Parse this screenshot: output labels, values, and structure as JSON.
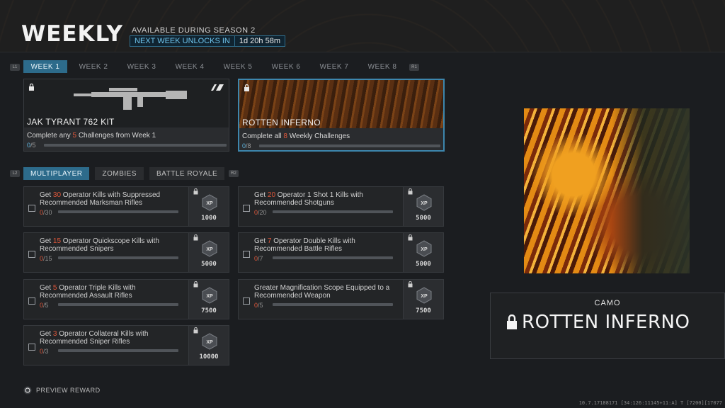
{
  "header": {
    "title": "WEEKLY",
    "subtitle": "AVAILABLE DURING SEASON 2",
    "unlock_label": "NEXT WEEK UNLOCKS IN",
    "unlock_time": "1d 20h 58m"
  },
  "hints": {
    "left_bumper": "L1",
    "right_bumper": "R1",
    "left_trigger": "L2",
    "right_trigger": "R2"
  },
  "weeks": [
    {
      "label": "WEEK 1",
      "active": true
    },
    {
      "label": "WEEK 2",
      "active": false
    },
    {
      "label": "WEEK 3",
      "active": false
    },
    {
      "label": "WEEK 4",
      "active": false
    },
    {
      "label": "WEEK 5",
      "active": false
    },
    {
      "label": "WEEK 6",
      "active": false
    },
    {
      "label": "WEEK 7",
      "active": false
    },
    {
      "label": "WEEK 8",
      "active": false
    }
  ],
  "rewards": [
    {
      "name": "JAK TYRANT 762 KIT",
      "desc_pre": "Complete any ",
      "desc_hl": "5",
      "desc_post": " Challenges from Week 1",
      "progress": "0",
      "total": "/5"
    },
    {
      "name": "ROTTEN INFERNO",
      "desc_pre": "Complete all ",
      "desc_hl": "8",
      "desc_post": " Weekly Challenges",
      "progress": "0",
      "total": "/8"
    }
  ],
  "modes": [
    {
      "label": "MULTIPLAYER",
      "active": true
    },
    {
      "label": "ZOMBIES",
      "active": false
    },
    {
      "label": "BATTLE ROYALE",
      "active": false
    }
  ],
  "challenges": [
    {
      "pre": "Get ",
      "hl": "30",
      "post": " Operator Kills with Suppressed Recommended Marksman Rifles",
      "progress": "0",
      "total": "/30",
      "xp": "1000"
    },
    {
      "pre": "Get ",
      "hl": "20",
      "post": " Operator 1 Shot 1 Kills with Recommended Shotguns",
      "progress": "0",
      "total": "/20",
      "xp": "5000"
    },
    {
      "pre": "Get ",
      "hl": "15",
      "post": " Operator Quickscope Kills with Recommended Snipers",
      "progress": "0",
      "total": "/15",
      "xp": "5000"
    },
    {
      "pre": "Get ",
      "hl": "7",
      "post": " Operator Double Kills with Recommended Battle Rifles",
      "progress": "0",
      "total": "/7",
      "xp": "5000"
    },
    {
      "pre": "Get ",
      "hl": "5",
      "post": " Operator Triple Kills with Recommended Assault Rifles",
      "progress": "0",
      "total": "/5",
      "xp": "7500"
    },
    {
      "pre": "",
      "hl": "",
      "post": "Greater Magnification Scope Equipped to a Recommended Weapon",
      "progress": "0",
      "total": "/5",
      "xp": "7500"
    },
    {
      "pre": "Get ",
      "hl": "3",
      "post": " Operator Collateral Kills with Recommended Sniper Rifles",
      "progress": "0",
      "total": "/3",
      "xp": "10000"
    }
  ],
  "xp_badge_text": "XP",
  "preview": {
    "type": "CAMO",
    "name": "ROTTEN INFERNO"
  },
  "footer": {
    "preview_label": "PREVIEW REWARD",
    "build_code": "10.7.17188171 [34:126:11145+11:A] T [7200][17077"
  },
  "colors": {
    "accent": "#2d6b8b",
    "highlight": "#e0573a",
    "progress": "#5fb3dd"
  }
}
